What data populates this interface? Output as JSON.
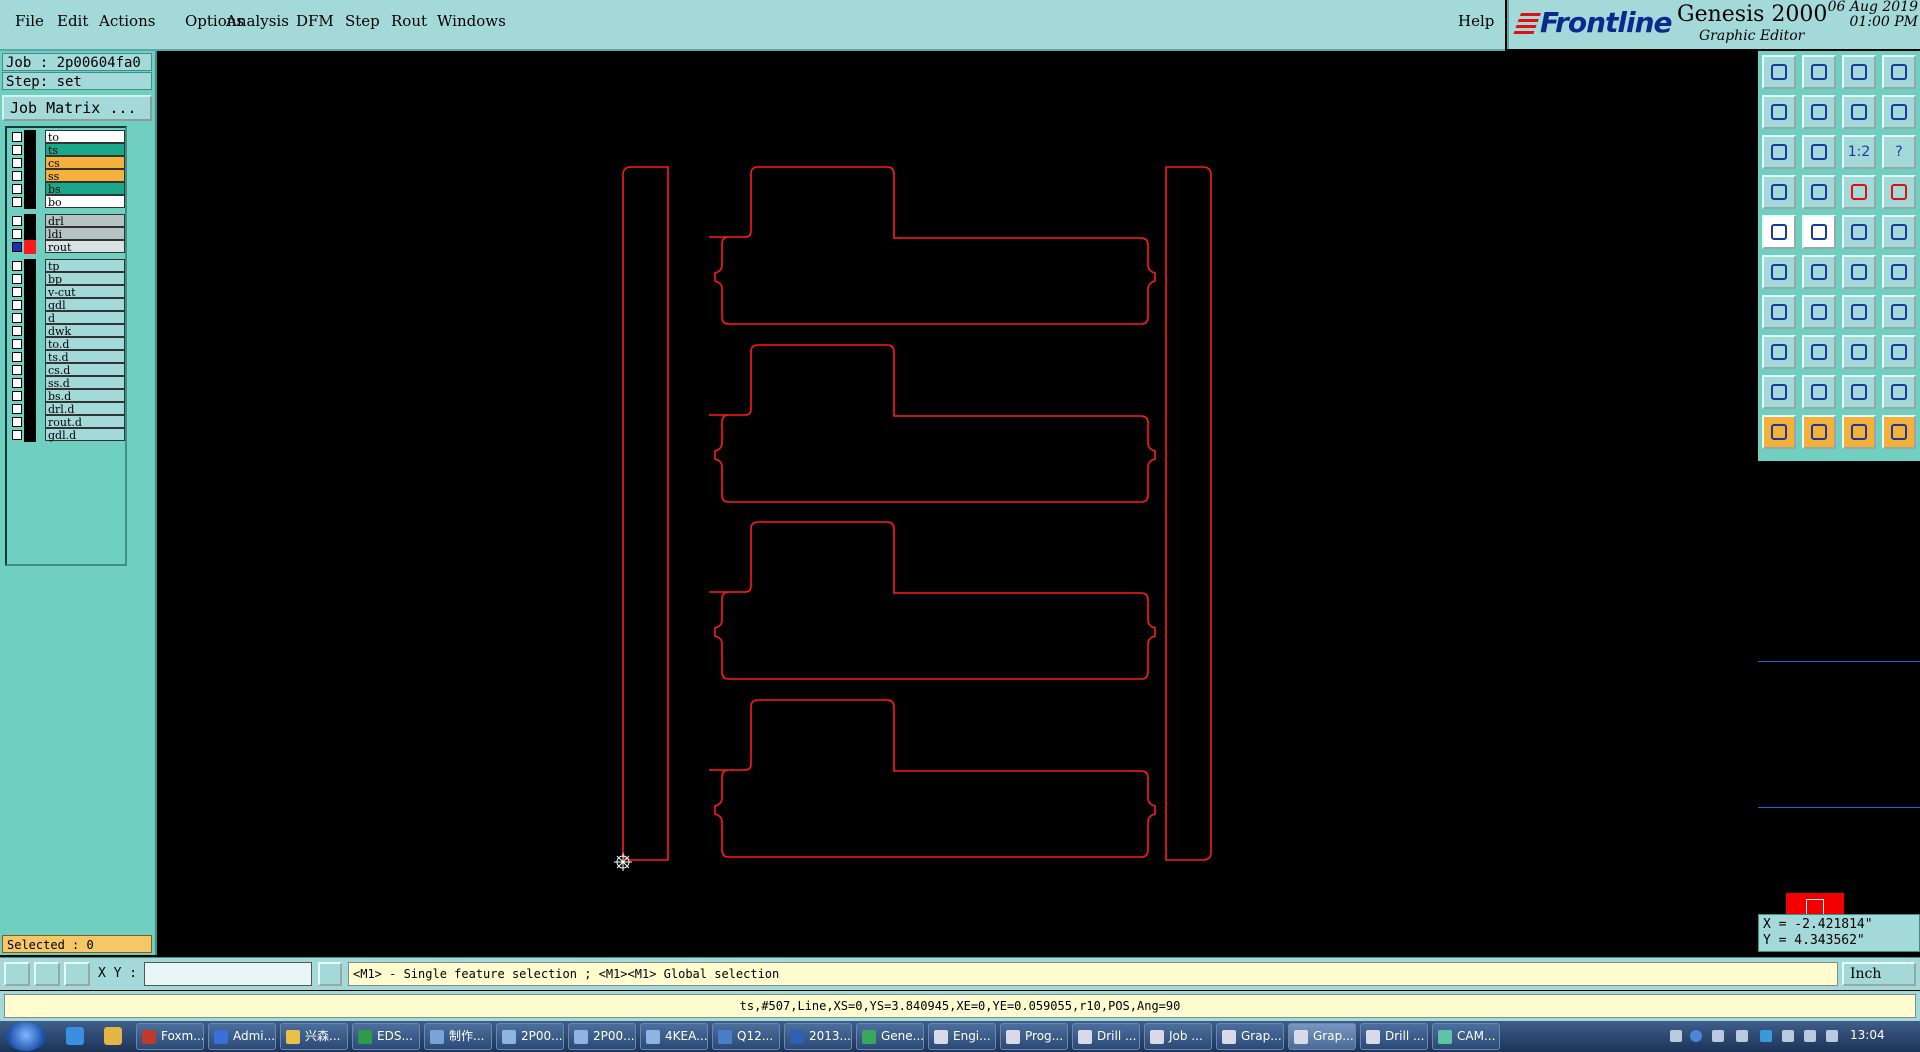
{
  "menubar": {
    "items": [
      "File",
      "Edit",
      "Actions",
      "Options",
      "Analysis",
      "DFM",
      "Step",
      "Rout",
      "Windows"
    ],
    "help": "Help"
  },
  "brand": {
    "logo": "Frontline",
    "product": "Genesis 2000",
    "subtitle": "Graphic Editor",
    "date": "06 Aug 2019",
    "time": "01:00 PM"
  },
  "job": {
    "job_label": "Job : 2p00604fa0",
    "step_label": "Step: set",
    "matrix_button": "Job Matrix ..."
  },
  "layers": [
    {
      "name": "to",
      "color": "#ffffff",
      "selected": false
    },
    {
      "name": "ts",
      "color": "#1aa88a",
      "selected": false
    },
    {
      "name": "cs",
      "color": "#f5b13e",
      "selected": false
    },
    {
      "name": "ss",
      "color": "#f5b13e",
      "selected": false
    },
    {
      "name": "bs",
      "color": "#1aa88a",
      "selected": false
    },
    {
      "name": "bo",
      "color": "#ffffff",
      "selected": false
    },
    {
      "name": "drl",
      "color": "#b5c3c3",
      "selected": false
    },
    {
      "name": "ldi",
      "color": "#b5c3c3",
      "selected": false
    },
    {
      "name": "rout",
      "color": "#d9e3e3",
      "selected": true
    },
    {
      "name": "tp",
      "color": "#a3dad9",
      "selected": false
    },
    {
      "name": "bp",
      "color": "#a3dad9",
      "selected": false
    },
    {
      "name": "v-cut",
      "color": "#a3dad9",
      "selected": false
    },
    {
      "name": "gdl",
      "color": "#a3dad9",
      "selected": false
    },
    {
      "name": "d",
      "color": "#a3dad9",
      "selected": false
    },
    {
      "name": "dwk",
      "color": "#a3dad9",
      "selected": false
    },
    {
      "name": "to.d",
      "color": "#a3dad9",
      "selected": false
    },
    {
      "name": "ts.d",
      "color": "#a3dad9",
      "selected": false
    },
    {
      "name": "cs.d",
      "color": "#a3dad9",
      "selected": false
    },
    {
      "name": "ss.d",
      "color": "#a3dad9",
      "selected": false
    },
    {
      "name": "bs.d",
      "color": "#a3dad9",
      "selected": false
    },
    {
      "name": "drl.d",
      "color": "#a3dad9",
      "selected": false
    },
    {
      "name": "rout.d",
      "color": "#a3dad9",
      "selected": false
    },
    {
      "name": "gdl.d",
      "color": "#a3dad9",
      "selected": false
    }
  ],
  "selected_count": "Selected : 0",
  "coords": {
    "x": "X = -2.421814\"",
    "y": "Y =  4.343562\""
  },
  "toolbar": {
    "button_labels": {
      "one_to_two": "1:2",
      "help": "?"
    }
  },
  "cmdbar": {
    "xy_label": "X Y :",
    "xy_value": "",
    "hint": "<M1> - Single feature selection ; <M1><M1> Global selection",
    "units": "Inch"
  },
  "status": {
    "text": "ts,#507,Line,XS=0,YS=3.840945,XE=0,YE=0.059055,r10,POS,Ang=90"
  },
  "taskbar": {
    "tasks": [
      "Foxm...",
      "Admi...",
      "兴森...",
      "EDS...",
      "制作...",
      "2P00...",
      "2P00...",
      "4KEA...",
      "Q12...",
      "2013...",
      "Gene...",
      "Engi...",
      "Prog...",
      "Drill ...",
      "Job ...",
      "Grap...",
      "Grap...",
      "Drill ...",
      "CAM..."
    ],
    "active_index": 16,
    "clock": "13:04"
  },
  "colors": {
    "panel": "#a3dad9",
    "outline": "#ff1a1a",
    "canvas": "#000000"
  }
}
